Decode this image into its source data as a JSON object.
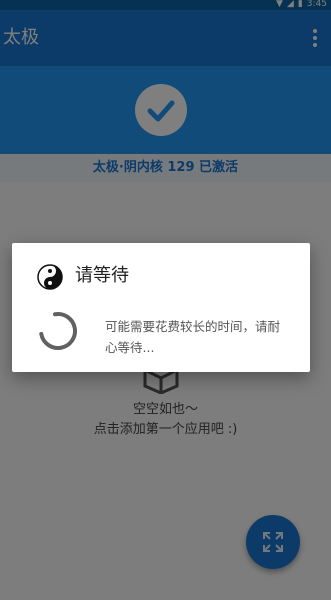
{
  "status_bar": {
    "time": "3:45"
  },
  "app_bar": {
    "title": "太极"
  },
  "banner": {
    "status_text": "太极·阴内核 129 已激活"
  },
  "empty_state": {
    "title": "空空如也～",
    "subtitle": "点击添加第一个应用吧 :)"
  },
  "dialog": {
    "title": "请等待",
    "message": "可能需要花费较长的时间，请耐心等待..."
  },
  "colors": {
    "primary": "#1976d2",
    "banner": "#2196f3",
    "status_bar": "#0a62a5",
    "scrim": "rgba(0,0,0,0.5)"
  },
  "icons": {
    "check": "check-icon",
    "yin_yang": "yin-yang-icon",
    "box": "box-icon",
    "fab": "expand-icon",
    "overflow": "more-vert-icon"
  }
}
